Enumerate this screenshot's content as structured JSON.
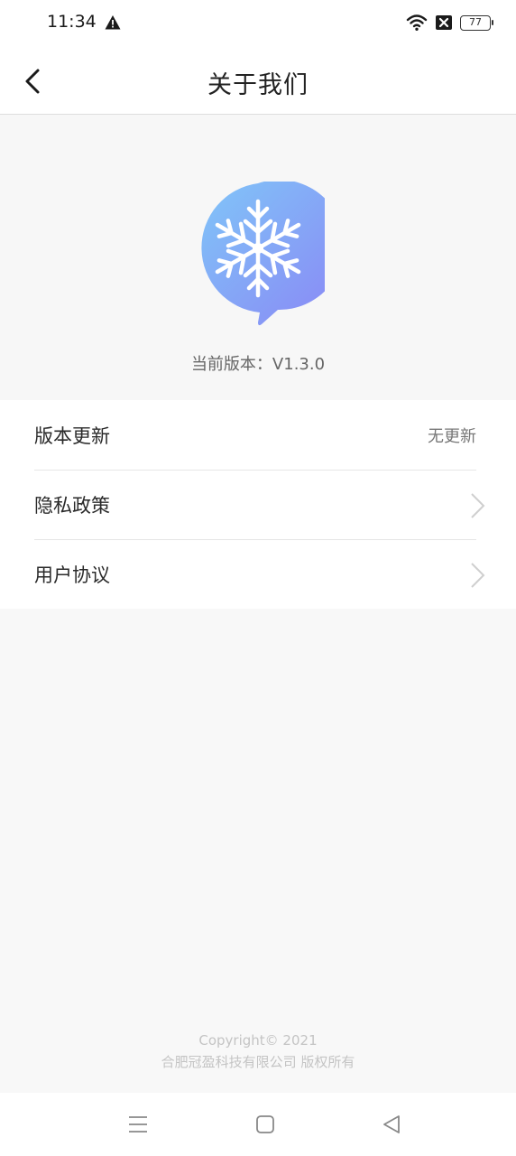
{
  "status_bar": {
    "time": "11:34",
    "battery": "77",
    "icons": [
      "warning-icon",
      "wifi-icon",
      "sim-off-icon",
      "battery-icon"
    ]
  },
  "nav": {
    "title": "关于我们",
    "back_icon": "chevron-left-icon"
  },
  "about": {
    "logo_icon": "snowflake-chat-bubble-logo",
    "version_text": "当前版本：V1.3.0"
  },
  "menu": {
    "items": [
      {
        "label": "版本更新",
        "status": "无更新"
      },
      {
        "label": "隐私政策",
        "icon": "chevron-right-icon"
      },
      {
        "label": "用户协议",
        "icon": "chevron-right-icon"
      }
    ]
  },
  "footer": {
    "line1": "Copyright© 2021",
    "line2": "合肥冠盈科技有限公司 版权所有"
  },
  "system_nav": {
    "icons": [
      "menu-icon",
      "home-icon",
      "back-icon"
    ]
  },
  "colors": {
    "page_bg": "#f8f8f8",
    "logo_gradient_start": "#7fc3f7",
    "logo_gradient_end": "#8a8cf6"
  }
}
